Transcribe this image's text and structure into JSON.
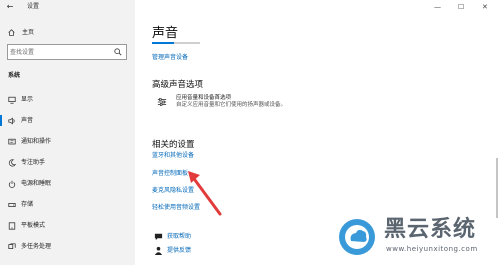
{
  "window": {
    "title": "设置",
    "controls": {
      "minimize": "—",
      "maximize": "☐",
      "close": "✕"
    }
  },
  "sidebar": {
    "home_label": "主页",
    "search_placeholder": "查找设置",
    "section_label": "系统",
    "items": [
      {
        "label": "显示",
        "icon": "monitor-icon",
        "active": false
      },
      {
        "label": "声音",
        "icon": "speaker-icon",
        "active": true
      },
      {
        "label": "通知和操作",
        "icon": "notification-icon",
        "active": false
      },
      {
        "label": "专注助手",
        "icon": "moon-icon",
        "active": false
      },
      {
        "label": "电源和睡眠",
        "icon": "power-icon",
        "active": false
      },
      {
        "label": "存储",
        "icon": "storage-icon",
        "active": false
      },
      {
        "label": "平板模式",
        "icon": "tablet-icon",
        "active": false
      },
      {
        "label": "多任务处理",
        "icon": "multitask-icon",
        "active": false
      }
    ]
  },
  "main": {
    "title": "声音",
    "progress": 0.45,
    "manage_link": "管理声音设备",
    "advanced": {
      "heading": "高级声音选项",
      "line1": "应用音量和设备首选项",
      "line2": "自定义应用音量和它们使用的扬声器或设备。"
    },
    "related": {
      "heading": "相关的设置",
      "links": [
        "蓝牙和其他设备",
        "声音控制面板",
        "麦克风隐私设置",
        "轻松使用音频设置"
      ]
    },
    "help": {
      "get_help": "获取帮助",
      "feedback": "提供反馈"
    }
  },
  "colors": {
    "accent": "#0078d7",
    "link": "#0067b8",
    "annotation": "#e23b3b"
  },
  "watermark": {
    "name": "黑云系统",
    "url": "www.heiyunxitong.com"
  }
}
